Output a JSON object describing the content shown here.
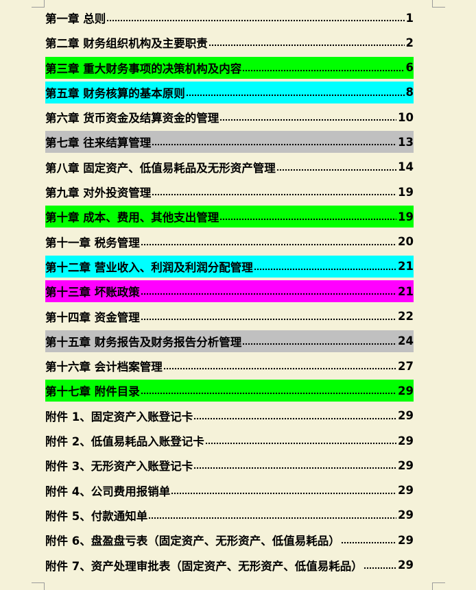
{
  "toc": [
    {
      "label": "第一章  总则",
      "page": "1",
      "highlight": ""
    },
    {
      "label": "第二章  财务组织机构及主要职责",
      "page": "2",
      "highlight": ""
    },
    {
      "label": "第三章  重大财务事项的决策机构及内容",
      "page": "6",
      "highlight": "#00ff00"
    },
    {
      "label": "第五章  财务核算的基本原则",
      "page": "8",
      "highlight": "#00ffff"
    },
    {
      "label": "第六章  货币资金及结算资金的管理",
      "page": "10",
      "highlight": ""
    },
    {
      "label": "第七章  往来结算管理",
      "page": "13",
      "highlight": "#c0c0c0"
    },
    {
      "label": "第八章  固定资产、低值易耗品及无形资产管理",
      "page": "14",
      "highlight": ""
    },
    {
      "label": "第九章  对外投资管理",
      "page": "19",
      "highlight": ""
    },
    {
      "label": "第十章  成本、费用、其他支出管理",
      "page": "19",
      "highlight": "#00ff00"
    },
    {
      "label": "第十一章  税务管理",
      "page": "20",
      "highlight": ""
    },
    {
      "label": "第十二章  营业收入、利润及利润分配管理",
      "page": "21",
      "highlight": "#00ffff"
    },
    {
      "label": "第十三章  坏账政策",
      "page": "21",
      "highlight": "#ff00ff"
    },
    {
      "label": "第十四章  资金管理",
      "page": "22",
      "highlight": ""
    },
    {
      "label": "第十五章  财务报告及财务报告分析管理",
      "page": "24",
      "highlight": "#c0c0c0"
    },
    {
      "label": "第十六章  会计档案管理",
      "page": "27",
      "highlight": ""
    },
    {
      "label": "第十七章  附件目录",
      "page": "29",
      "highlight": "#00ff00"
    },
    {
      "label": "附件 1、固定资产入账登记卡",
      "page": "29",
      "highlight": ""
    },
    {
      "label": "附件 2、低值易耗品入账登记卡",
      "page": "29",
      "highlight": ""
    },
    {
      "label": "附件 3、无形资产入账登记卡",
      "page": "29",
      "highlight": ""
    },
    {
      "label": "附件 4、公司费用报销单",
      "page": "29",
      "highlight": ""
    },
    {
      "label": "附件 5、付款通知单",
      "page": "29",
      "highlight": ""
    },
    {
      "label": "附件 6、盘盈盘亏表（固定资产、无形资产、低值易耗品）",
      "page": "29",
      "highlight": ""
    },
    {
      "label": "附件 7、资产处理审批表（固定资产、无形资产、低值易耗品）",
      "page": "29",
      "highlight": ""
    }
  ]
}
